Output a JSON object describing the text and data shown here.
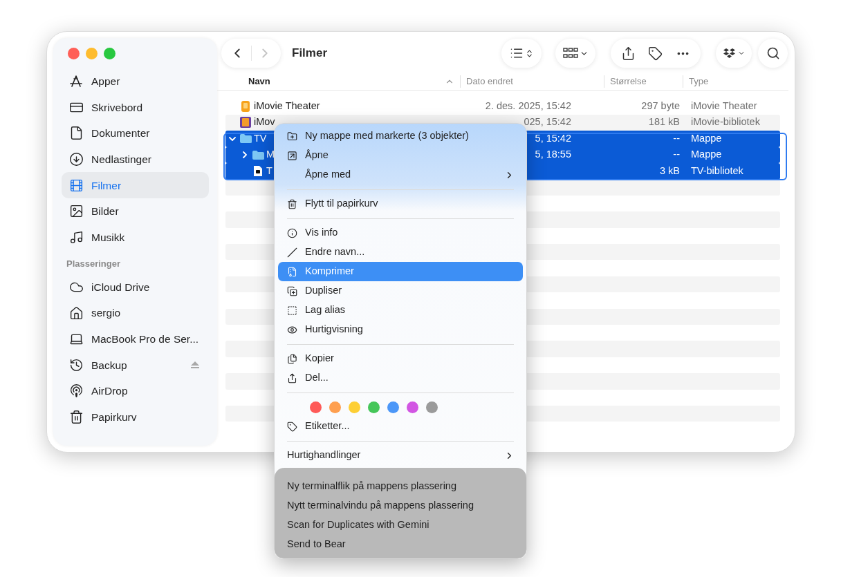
{
  "toolbar": {
    "back": {
      "disabled": false
    },
    "forward": {
      "disabled": true
    },
    "title": "Filmer"
  },
  "sidebar": {
    "sections": [
      {
        "items": [
          {
            "label": "Apper",
            "selected": false,
            "ejectable": false
          },
          {
            "label": "Skrivebord",
            "selected": false,
            "ejectable": false
          },
          {
            "label": "Dokumenter",
            "selected": false,
            "ejectable": false
          },
          {
            "label": "Nedlastinger",
            "selected": false,
            "ejectable": false
          },
          {
            "label": "Filmer",
            "selected": true,
            "ejectable": false
          },
          {
            "label": "Bilder",
            "selected": false,
            "ejectable": false
          },
          {
            "label": "Musikk",
            "selected": false,
            "ejectable": false
          }
        ]
      },
      {
        "header": "Plasseringer",
        "items": [
          {
            "label": "iCloud Drive",
            "selected": false,
            "ejectable": false
          },
          {
            "label": "sergio",
            "selected": false,
            "ejectable": false
          },
          {
            "label": "MacBook Pro de Ser...",
            "selected": false,
            "ejectable": false
          },
          {
            "label": "Backup",
            "selected": false,
            "ejectable": true
          },
          {
            "label": "AirDrop",
            "selected": false,
            "ejectable": false
          },
          {
            "label": "Papirkurv",
            "selected": false,
            "ejectable": false
          }
        ]
      }
    ]
  },
  "table": {
    "columns": [
      {
        "label": "Navn",
        "sorted": true
      },
      {
        "label": "Dato endret",
        "sorted": false
      },
      {
        "label": "Størrelse",
        "sorted": false
      },
      {
        "label": "Type",
        "sorted": false
      }
    ],
    "rows": [
      {
        "kind": "theater",
        "name": "iMovie Theater",
        "date": "2. des. 2025, 15:42",
        "size": "297 byte",
        "type": "iMovie Theater",
        "selected": false
      },
      {
        "kind": "library",
        "name": "iMov",
        "date": "025, 15:42",
        "size": "181 kB",
        "type": "iMovie-bibliotek",
        "selected": false
      },
      {
        "kind": "folder",
        "name": "TV",
        "date": "5, 15:42",
        "size": "--",
        "type": "Mappe",
        "selected": true,
        "expanded": true,
        "children": [
          {
            "kind": "folder",
            "name": "M",
            "date": "5, 18:55",
            "size": "--",
            "type": "Mappe",
            "selected": true,
            "expanded": false
          },
          {
            "kind": "tvlib",
            "name": "T",
            "size": "3 kB",
            "type": "TV-bibliotek",
            "selected": true
          }
        ]
      }
    ]
  },
  "context_menu": {
    "items": [
      {
        "kind": "item",
        "label": "Ny mappe med markerte (3 objekter)",
        "submenu": false,
        "selected": false
      },
      {
        "kind": "item",
        "label": "Åpne",
        "submenu": false,
        "selected": false
      },
      {
        "kind": "item",
        "label": "Åpne med",
        "submenu": true,
        "selected": false
      },
      {
        "kind": "separator"
      },
      {
        "kind": "item",
        "label": "Flytt til papirkurv",
        "submenu": false,
        "selected": false
      },
      {
        "kind": "separator"
      },
      {
        "kind": "item",
        "label": "Vis info",
        "submenu": false,
        "selected": false
      },
      {
        "kind": "item",
        "label": "Endre navn...",
        "submenu": false,
        "selected": false
      },
      {
        "kind": "item",
        "label": "Komprimer",
        "submenu": false,
        "selected": true
      },
      {
        "kind": "item",
        "label": "Dupliser",
        "submenu": false,
        "selected": false
      },
      {
        "kind": "item",
        "label": "Lag alias",
        "submenu": false,
        "selected": false
      },
      {
        "kind": "item",
        "label": "Hurtigvisning",
        "submenu": false,
        "selected": false
      },
      {
        "kind": "separator"
      },
      {
        "kind": "item",
        "label": "Kopier",
        "submenu": false,
        "selected": false
      },
      {
        "kind": "item",
        "label": "Del...",
        "submenu": false,
        "selected": false
      },
      {
        "kind": "separator"
      },
      {
        "kind": "tags",
        "tags": [
          {
            "color": "#fe5a58"
          },
          {
            "color": "#fe9f4f"
          },
          {
            "color": "#fdcf35"
          },
          {
            "color": "#45c659"
          },
          {
            "color": "#4c97f8"
          },
          {
            "color": "#d256e3"
          },
          {
            "color": "#9b9b9b"
          }
        ]
      },
      {
        "kind": "item",
        "label": "Etiketter...",
        "submenu": false,
        "selected": false
      },
      {
        "kind": "separator"
      },
      {
        "kind": "item",
        "label": "Hurtighandlinger",
        "submenu": true,
        "selected": false
      }
    ],
    "services": [
      "Ny terminalflik på mappens plassering",
      "Nytt terminalvindu på mappens plassering",
      "Scan for Duplicates with Gemini",
      "Send to Bear"
    ]
  }
}
